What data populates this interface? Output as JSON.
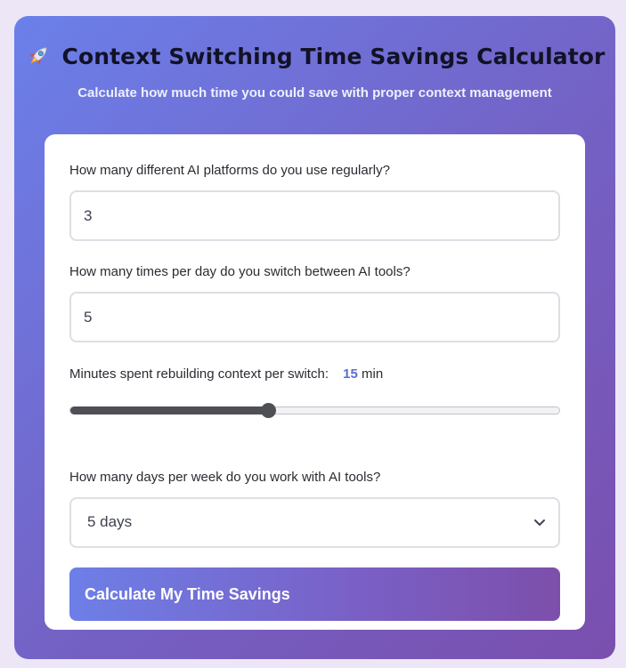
{
  "header": {
    "icon": "rocket-icon",
    "title": "Context Switching Time Savings Calculator",
    "subtitle": "Calculate how much time you could save with proper context management"
  },
  "form": {
    "platforms": {
      "label": "How many different AI platforms do you use regularly?",
      "value": "3"
    },
    "switches": {
      "label": "How many times per day do you switch between AI tools?",
      "value": "5"
    },
    "rebuild": {
      "label": "Minutes spent rebuilding context per switch:",
      "value": "15",
      "unit": "min",
      "fraction": 0.405
    },
    "days": {
      "label": "How many days per week do you work with AI tools?",
      "selected": "5 days"
    },
    "submit_label": "Calculate My Time Savings"
  },
  "colors": {
    "accent": "#5b6dd6",
    "gradient_start": "#6b80ea",
    "gradient_end": "#7a4fae"
  }
}
